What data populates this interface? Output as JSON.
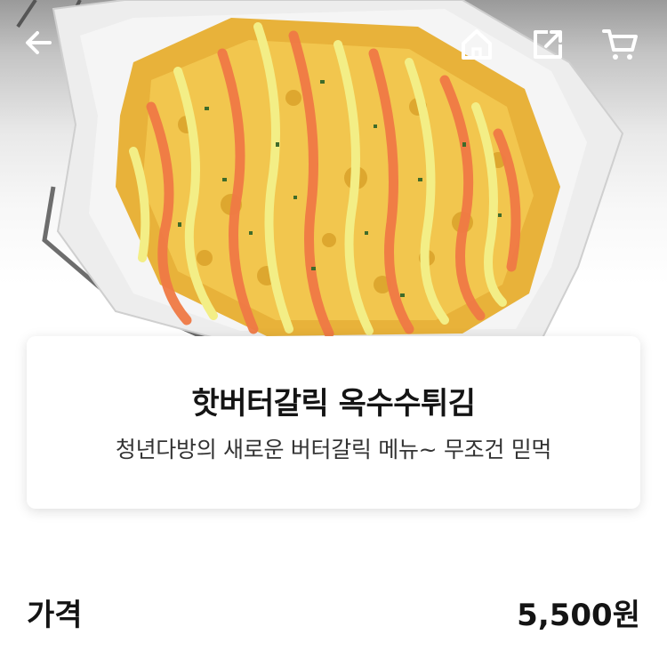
{
  "header": {
    "back_icon": "arrow-left-icon",
    "home_icon": "home-icon",
    "share_icon": "share-icon",
    "cart_icon": "cart-icon"
  },
  "product": {
    "image": "fried-corn-with-sauce-photo",
    "title": "핫버터갈릭 옥수수튀김",
    "description": "청년다방의 새로운 버터갈릭 메뉴~ 무조건 믿먹"
  },
  "price": {
    "label": "가격",
    "value": "5,500원"
  },
  "colors": {
    "sauce_orange": "#F07A45",
    "sauce_yellow": "#F3EE86",
    "fried_gold": "#E8B23A"
  }
}
